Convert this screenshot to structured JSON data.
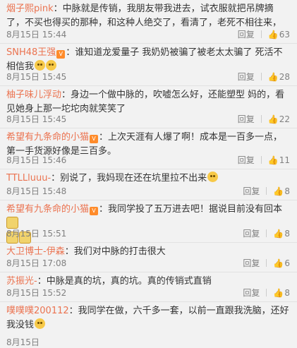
{
  "comments": [
    {
      "user": "烟子熙pink",
      "text": "：中脉就是传销，我朋友带我进去，试衣服就把吊牌摘了，不买也得买的那种，和这种人绝交了，看清了，老死不相往来，",
      "time": "8月15日 15:44",
      "reply": "回复",
      "likes": "63"
    },
    {
      "user": "SNH48王强",
      "text": "：谁知道龙爱量子 我奶奶被骗了被老太太骗了 死活不相信我",
      "time": "8月15日 15:45",
      "reply": "回复",
      "likes": "28"
    },
    {
      "user": "柚子味儿浮动",
      "text": "：身边一个做中脉的，吹嘘怎么好，还能塑型 妈的，看见她身上那一坨坨肉就笑笑了",
      "time": "8月15日 15:45",
      "reply": "回复",
      "likes": "22"
    },
    {
      "user": "希望有九条命的小猫",
      "text": "：上次天涯有人爆了啊！成本是一百多一点，第一手货源好像是三百多。",
      "time": "8月15日 15:46",
      "reply": "回复",
      "likes": "11"
    },
    {
      "user": "TTLLluuu-",
      "text": "：别说了，我妈现在还在坑里拉不出来",
      "time": "8月15日 15:48",
      "reply": "回复",
      "likes": "8"
    },
    {
      "user": "希望有九条命的小猫",
      "text": "：我同学投了五万进去吧！据说目前没有回本",
      "time": "8月15日 15:51",
      "reply": "回复",
      "likes": "8"
    },
    {
      "user": "大卫博士-伊森",
      "text": "：我们对中脉的打击很大",
      "time": "8月15日 17:08",
      "reply": "回复",
      "likes": "6"
    },
    {
      "user": "苏振光-",
      "text": "：中脉是真的坑，真的坑。真的传销式直销",
      "time": "8月15日 15:52",
      "reply": "回复",
      "likes": "8"
    },
    {
      "user": "噗噗噗200112",
      "text": "：我同学在做，六千多一套，以前一直跟我洗脑，还好我没钱",
      "time": "8月15日",
      "reply": "",
      "likes": ""
    }
  ],
  "icons": {
    "like": "thumb-up-icon",
    "badge": "vip-badge-icon",
    "emoji": "emoji-icon",
    "cat": "cat-sticker-icon"
  },
  "colors": {
    "username": "#eb7350",
    "meta": "#808080",
    "background": "#f2f2f2"
  }
}
